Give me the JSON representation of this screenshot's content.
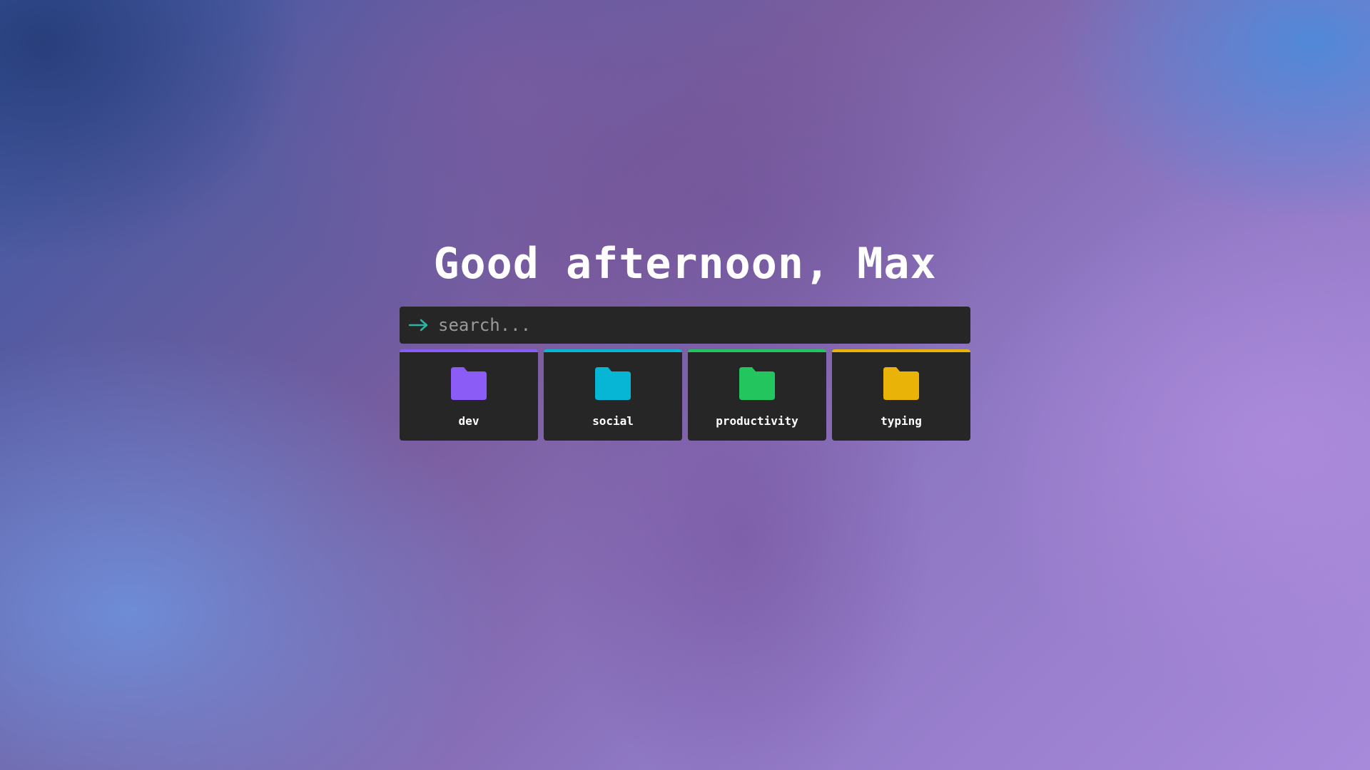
{
  "greeting": "Good afternoon, Max",
  "search": {
    "placeholder": "search...",
    "value": "",
    "icon": "arrow-right-icon",
    "icon_color": "#2bb3a6"
  },
  "folders": [
    {
      "label": "dev",
      "icon": "folder-icon",
      "color": "#8b5cf6"
    },
    {
      "label": "social",
      "icon": "folder-icon",
      "color": "#06b6d4"
    },
    {
      "label": "productivity",
      "icon": "folder-icon",
      "color": "#22c55e"
    },
    {
      "label": "typing",
      "icon": "folder-icon",
      "color": "#eab308"
    }
  ],
  "colors": {
    "panel": "#262626",
    "text": "#ffffff"
  }
}
